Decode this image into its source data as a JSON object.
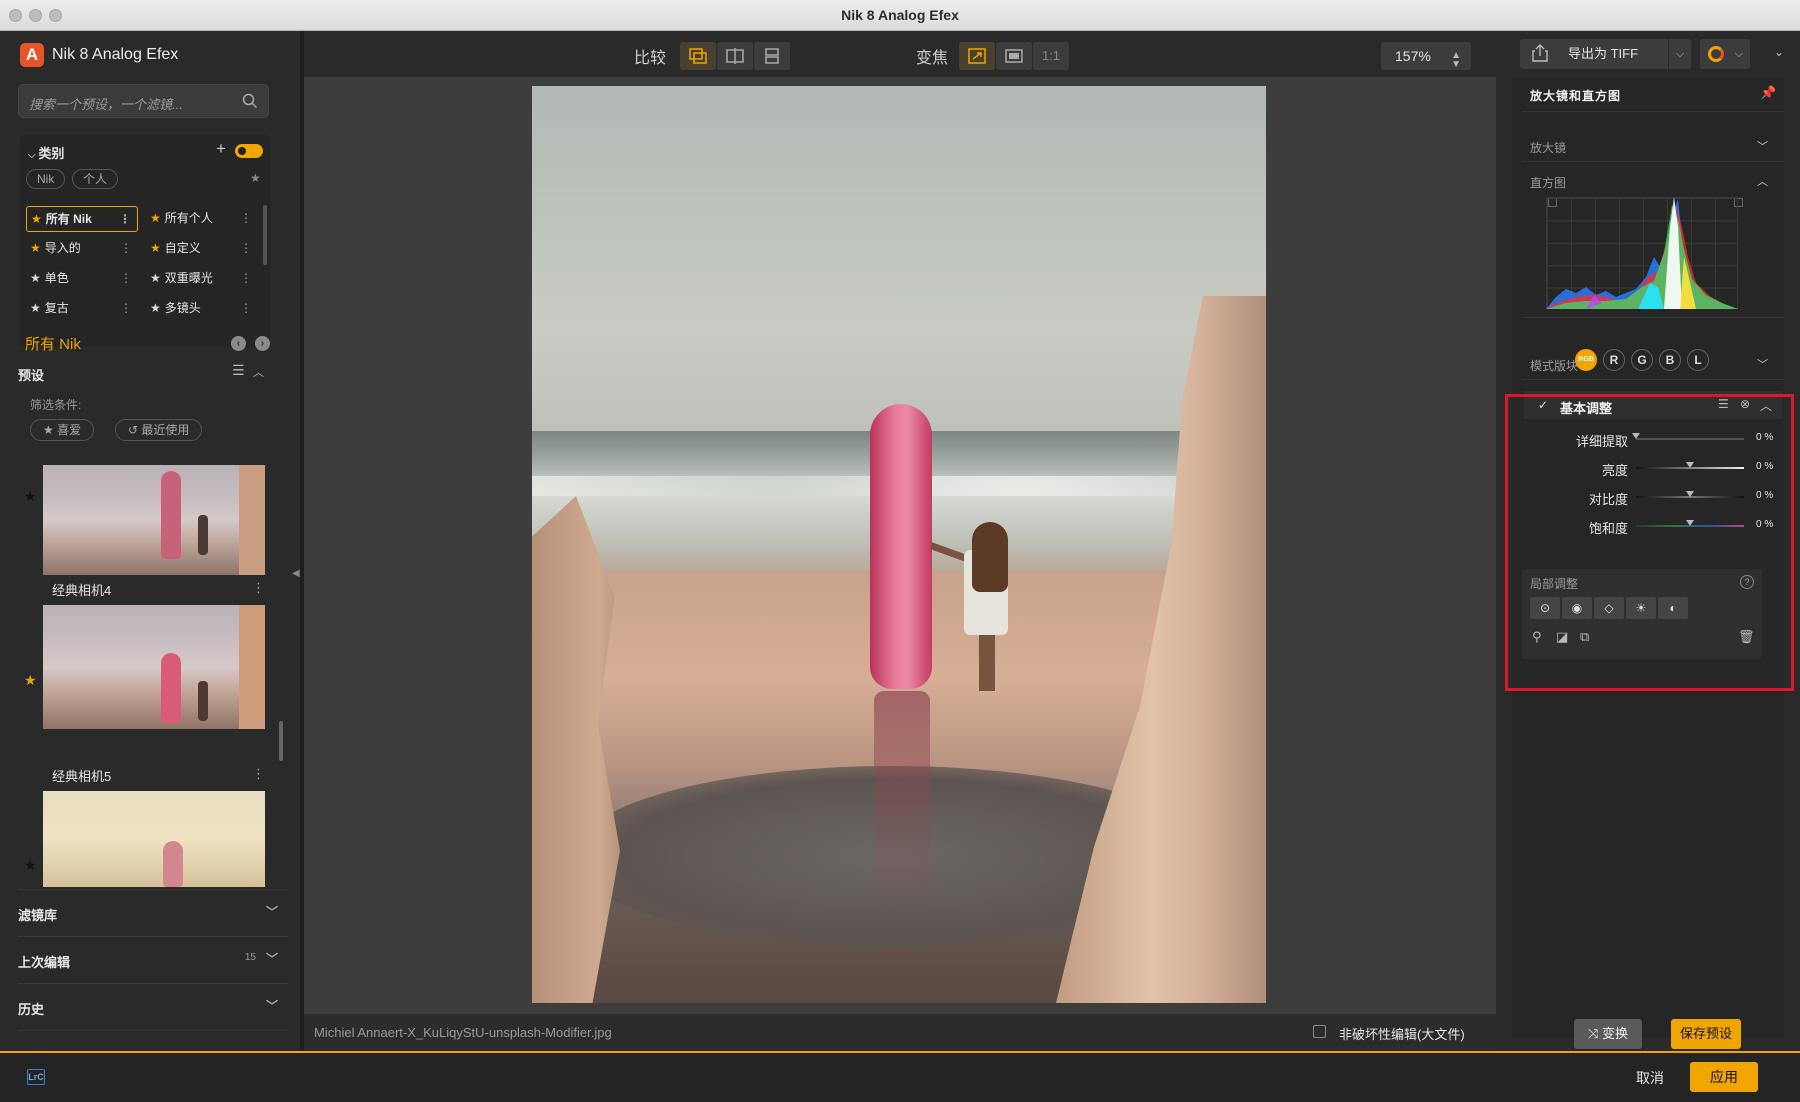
{
  "window": {
    "title": "Nik 8 Analog Efex"
  },
  "left": {
    "app_name": "Nik 8 Analog Efex",
    "search_placeholder": "搜索一个预设，一个滤镜...",
    "categories": {
      "title": "类别",
      "chips": [
        "Nik",
        "个人"
      ],
      "items": [
        {
          "label": "所有 Nik",
          "starred": true,
          "selected": true
        },
        {
          "label": "所有个人",
          "starred": true,
          "selected": false
        },
        {
          "label": "导入的",
          "starred": true,
          "selected": false
        },
        {
          "label": "自定义",
          "starred": false,
          "selected": false
        },
        {
          "label": "单色",
          "starred": false,
          "selected": false
        },
        {
          "label": "双重曝光",
          "starred": false,
          "selected": false
        },
        {
          "label": "复古",
          "starred": false,
          "selected": false
        },
        {
          "label": "多镜头",
          "starred": false,
          "selected": false
        }
      ]
    },
    "current_collection": "所有 Nik",
    "presets": {
      "title": "预设",
      "filter_label": "筛选条件:",
      "filter_chips": [
        "喜爱",
        "最近使用"
      ],
      "thumbnails": [
        {
          "label": "经典相机4",
          "starred": false
        },
        {
          "label": "经典相机5",
          "starred": true
        },
        {
          "label": "",
          "starred": false
        }
      ]
    },
    "sections": [
      {
        "label": "滤镜库",
        "count": ""
      },
      {
        "label": "上次编辑",
        "count": "15"
      },
      {
        "label": "历史",
        "count": ""
      }
    ]
  },
  "toolbar": {
    "compare_label": "比较",
    "zoom_label": "变焦",
    "one_to_one": "1:1",
    "zoom_value": "157%"
  },
  "status": {
    "filename": "Michiel Annaert-X_KuLiqyStU-unsplash-Modifier.jpg",
    "nondestructive_label": "非破坏性编辑(大文件)"
  },
  "right": {
    "export_label": "导出为 TIFF",
    "loupe_histogram_title": "放大镜和直方图",
    "loupe_label": "放大镜",
    "histogram_label": "直方图",
    "channels": [
      "RGB",
      "R",
      "G",
      "B",
      "L"
    ],
    "mode_label": "模式版块",
    "basic": {
      "title": "基本调整",
      "sliders": [
        {
          "label": "详细提取",
          "value": "0 %",
          "level": 0
        },
        {
          "label": "亮度",
          "value": "0 %",
          "level": 0.5
        },
        {
          "label": "对比度",
          "value": "0 %",
          "level": 0.5
        },
        {
          "label": "饱和度",
          "value": "0 %",
          "level": 0.5
        }
      ],
      "local_title": "局部调整",
      "help": "?"
    },
    "randomize_label": "变换",
    "save_preset_label": "保存预设"
  },
  "footer": {
    "lrc": "LrC",
    "cancel": "取消",
    "apply": "应用"
  },
  "colors": {
    "accent": "#f0a500",
    "highlight_frame": "#d8192b"
  }
}
